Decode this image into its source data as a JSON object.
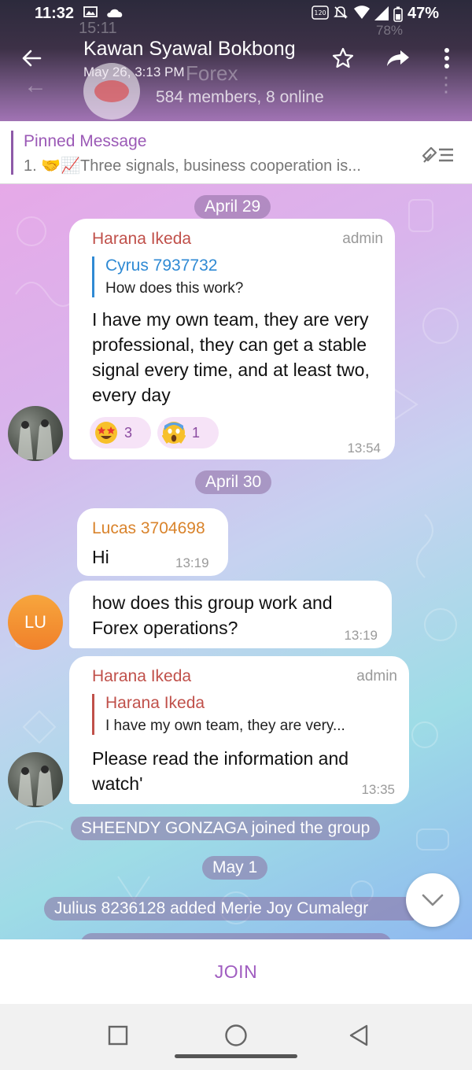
{
  "status_bar": {
    "time": "11:32",
    "battery": "47%",
    "ghost_time": "15:11",
    "ghost_battery": "78%"
  },
  "header": {
    "title": "Kawan Syawal Bokbong",
    "subtitle": "May 26, 3:13 PM",
    "ghost_title_fragment": "Forex",
    "members_text": "584 members, 8 online"
  },
  "pinned": {
    "title": "Pinned Message",
    "text": "1. 🤝📈Three signals, business cooperation is..."
  },
  "messages": [
    {
      "date": "April 29",
      "sender": "Harana Ikeda",
      "role": "admin",
      "reply_name": "Cyrus 7937732",
      "reply_text": "How does this work?",
      "text": "I have my own team, they are very professional, they can get a stable signal every time, and at least two, every day",
      "reactions": [
        {
          "emoji": "star-struck",
          "count": "3"
        },
        {
          "emoji": "screaming-face",
          "count": "1"
        }
      ],
      "time": "13:54"
    },
    {
      "date": "April 30",
      "sender": "Lucas 3704698",
      "text": "Hi",
      "time": "13:19",
      "avatar_initials": "LU"
    },
    {
      "text": "how does this group work and Forex operations?",
      "time": "13:19"
    },
    {
      "sender": "Harana Ikeda",
      "role": "admin",
      "reply_name": "Harana Ikeda",
      "reply_text": "I have my own team, they are very...",
      "text": "Please read the information and watch'",
      "time": "13:35"
    }
  ],
  "service": {
    "joined": "SHEENDY GONZAGA joined the group",
    "date_may": "May 1",
    "added": "Julius 8236128 added Merie Joy Cumalegr"
  },
  "join_label": "JOIN",
  "colors": {
    "accent": "#9b59b6",
    "sender_red": "#c0504a",
    "sender_orange": "#d9832b",
    "reply_blue": "#2f8ad4"
  }
}
